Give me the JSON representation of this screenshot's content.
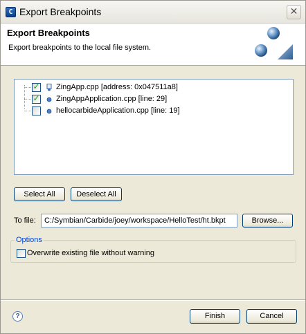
{
  "window": {
    "title": "Export Breakpoints",
    "app_icon": "carbide-c-icon",
    "close_glyph": "✕"
  },
  "header": {
    "title": "Export Breakpoints",
    "description": "Export breakpoints to the local file system."
  },
  "breakpoints": [
    {
      "label": "ZingApp.cpp [address: 0x047511a8]",
      "checked": true,
      "icon": "address-breakpoint-icon"
    },
    {
      "label": "ZingAppApplication.cpp [line: 29]",
      "checked": true,
      "icon": "line-breakpoint-icon"
    },
    {
      "label": "hellocarbideApplication.cpp [line: 19]",
      "checked": false,
      "icon": "line-breakpoint-icon"
    }
  ],
  "buttons": {
    "select_all": "Select All",
    "deselect_all": "Deselect All",
    "browse": "Browse...",
    "finish": "Finish",
    "cancel": "Cancel"
  },
  "to_file": {
    "label": "To file:",
    "value": "C:/Symbian/Carbide/joey/workspace/HelloTest/ht.bkpt"
  },
  "options": {
    "legend": "Options",
    "overwrite_label": "Overwrite existing file without warning",
    "overwrite_checked": false
  },
  "help": {
    "glyph": "?"
  },
  "colors": {
    "dialog_bg": "#ece9d8",
    "legend": "#0046d5",
    "check": "#21a121",
    "field_border": "#7f9db9"
  }
}
